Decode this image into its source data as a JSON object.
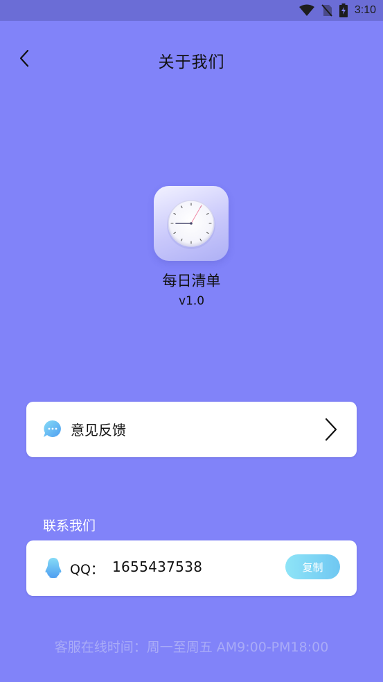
{
  "status_bar": {
    "time": "3:10",
    "icons": [
      "wifi-icon",
      "no-sim-icon",
      "battery-charging-icon"
    ]
  },
  "header": {
    "back_icon": "chevron-left-icon",
    "title": "关于我们"
  },
  "app": {
    "icon": "clock-icon",
    "name": "每日清单",
    "version": "v1.0"
  },
  "feedback": {
    "icon": "chat-bubble-icon",
    "label": "意见反馈",
    "arrow_icon": "chevron-right-icon"
  },
  "contact": {
    "section_title": "联系我们",
    "qq_icon": "qq-penguin-icon",
    "qq_label": "QQ：",
    "qq_number": "1655437538",
    "copy_label": "复制"
  },
  "footer": {
    "service_hours": "客服在线时间：周一至周五 AM9:00-PM18:00"
  },
  "colors": {
    "background": "#8183f9",
    "status_bar": "#6b6dd6",
    "card": "#ffffff",
    "copy_button": "#7fd5f5",
    "muted_text": "#a9abf7"
  }
}
